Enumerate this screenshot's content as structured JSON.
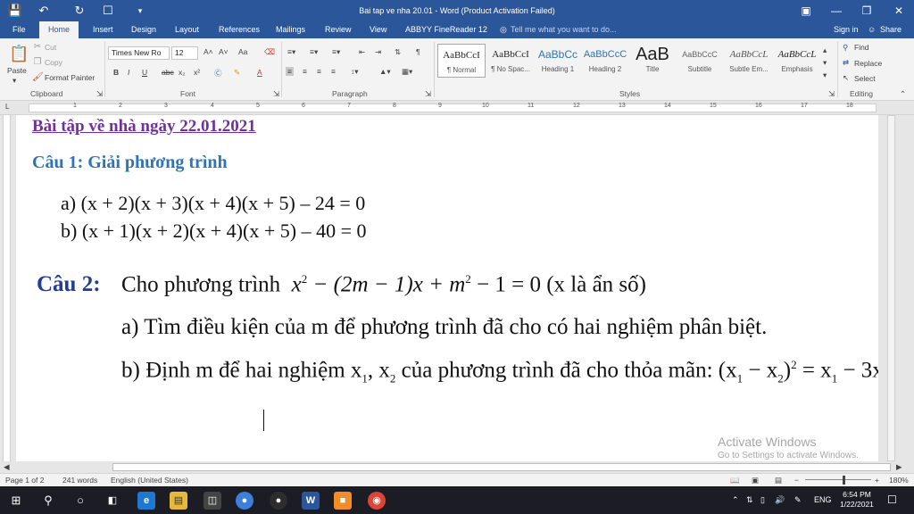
{
  "titlebar": {
    "title": "Bai tap ve nha 20.01 - Word (Product Activation Failed)",
    "save_icon": "save-icon",
    "undo_icon": "undo-icon",
    "redo_icon": "redo-icon",
    "print_preview_icon": "print-preview-icon",
    "customize_icon": "customize-quick-access-icon"
  },
  "tabs": [
    {
      "label": "File"
    },
    {
      "label": "Home"
    },
    {
      "label": "Insert"
    },
    {
      "label": "Design"
    },
    {
      "label": "Layout"
    },
    {
      "label": "References"
    },
    {
      "label": "Mailings"
    },
    {
      "label": "Review"
    },
    {
      "label": "View"
    },
    {
      "label": "ABBYY FineReader 12"
    }
  ],
  "active_tab": "Home",
  "tell_me_placeholder": "Tell me what you want to do...",
  "sign_in": "Sign in",
  "share": "Share",
  "ribbon": {
    "clipboard": {
      "paste": "Paste",
      "cut": "Cut",
      "copy": "Copy",
      "format_painter": "Format Painter",
      "label": "Clipboard"
    },
    "font": {
      "font_name": "Times New Ro",
      "font_size": "12",
      "label": "Font",
      "bold": "B",
      "italic": "I",
      "underline": "U",
      "strike": "abc",
      "subscript": "x₂",
      "superscript": "x²",
      "grow": "A˄",
      "shrink": "A˅",
      "case": "Aa",
      "clear": "A"
    },
    "paragraph": {
      "label": "Paragraph"
    },
    "styles": {
      "label": "Styles",
      "items": [
        {
          "preview": "AaBbCcI",
          "name": "¶ Normal"
        },
        {
          "preview": "AaBbCcI",
          "name": "¶ No Spac..."
        },
        {
          "preview": "AaBbCc",
          "name": "Heading 1"
        },
        {
          "preview": "AaBbCcC",
          "name": "Heading 2"
        },
        {
          "preview": "AaB",
          "name": "Title"
        },
        {
          "preview": "AaBbCcC",
          "name": "Subtitle"
        },
        {
          "preview": "AaBbCcL",
          "name": "Subtle Em..."
        },
        {
          "preview": "AaBbCcL",
          "name": "Emphasis"
        }
      ]
    },
    "editing": {
      "find": "Find",
      "replace": "Replace",
      "select": "Select",
      "label": "Editing"
    }
  },
  "ruler": {
    "ticks": [
      "1",
      "2",
      "3",
      "4",
      "5",
      "6",
      "7",
      "8",
      "9",
      "10",
      "11",
      "12",
      "13",
      "14",
      "15",
      "16",
      "17",
      "18"
    ]
  },
  "document": {
    "heading": "Bài tập về nhà ngày 22.01.2021",
    "q1_title": "Câu 1: Giải phương trình",
    "q1_a": "a)  (x + 2)(x + 3)(x + 4)(x + 5) – 24 = 0",
    "q1_b": "b)  (x + 1)(x + 2)(x + 4)(x + 5) – 40 = 0",
    "q2_label": "Câu 2:",
    "q2_intro": "Cho phương trình",
    "q2_eq_left": "x",
    "q2_eq_mid": " − (2m − 1)x + m",
    "q2_eq_right": " − 1 = 0",
    "q2_paren": " (x  là ẩn số)",
    "q2_a": "a)  Tìm điều kiện của  m  để phương trình đã cho có hai nghiệm phân biệt.",
    "q2_b_text": "b)  Định  m  để hai nghiệm  x",
    "q2_b_x2": ",  x",
    "q2_b_mid": "  của phương trình đã cho thỏa mãn: (x",
    "q2_b_minus": " − x",
    "q2_b_rhs": ")",
    "q2_b_eq": " = x",
    "q2_b_end": " − 3x",
    "q2_b_dot": " .",
    "sup2": "2",
    "sub1": "1",
    "sub2": "2"
  },
  "watermark": {
    "line1": "Activate Windows",
    "line2": "Go to Settings to activate Windows."
  },
  "status": {
    "page": "Page 1 of 2",
    "words": "241 words",
    "lang": "English (United States)",
    "zoom": "180%"
  },
  "taskbar": {
    "time": "6:54 PM",
    "date": "1/22/2021",
    "lang": "ENG"
  }
}
